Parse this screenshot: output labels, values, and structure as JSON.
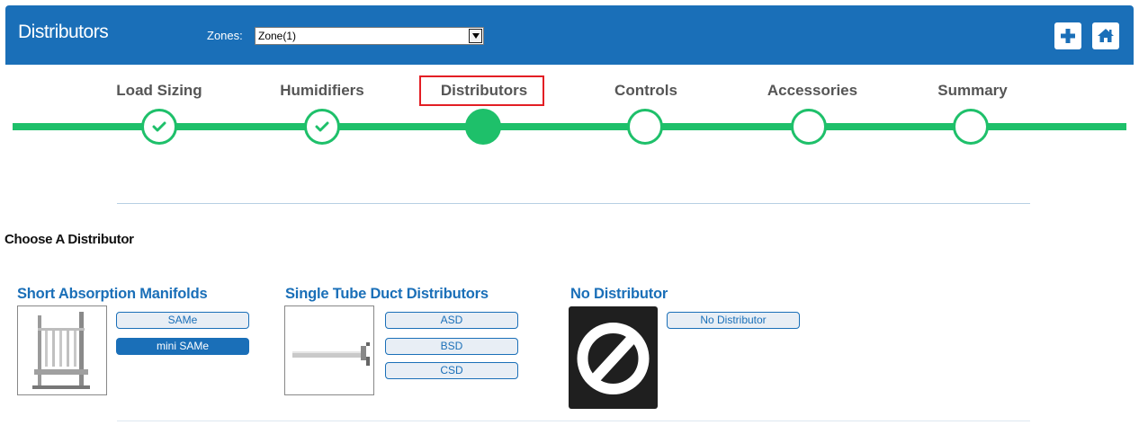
{
  "header": {
    "title": "Distributors",
    "zones_label": "Zones:",
    "zones_value": "Zone(1)"
  },
  "steps": [
    {
      "label": "Load Sizing",
      "state": "complete"
    },
    {
      "label": "Humidifiers",
      "state": "complete"
    },
    {
      "label": "Distributors",
      "state": "current"
    },
    {
      "label": "Controls",
      "state": "pending"
    },
    {
      "label": "Accessories",
      "state": "pending"
    },
    {
      "label": "Summary",
      "state": "pending"
    }
  ],
  "section_title": "Choose A Distributor",
  "groups": [
    {
      "title": "Short Absorption Manifolds",
      "options": [
        {
          "label": "SAMe",
          "selected": false
        },
        {
          "label": "mini SAMe",
          "selected": true
        }
      ]
    },
    {
      "title": "Single Tube Duct Distributors",
      "options": [
        {
          "label": "ASD",
          "selected": false
        },
        {
          "label": "BSD",
          "selected": false
        },
        {
          "label": "CSD",
          "selected": false
        }
      ]
    },
    {
      "title": "No Distributor",
      "options": [
        {
          "label": "No Distributor",
          "selected": false
        }
      ]
    }
  ],
  "colors": {
    "primary": "#1a6fb8",
    "progress": "#1ec06a",
    "highlight": "#e31e24"
  },
  "icons": {
    "add": "plus-icon",
    "home": "home-icon"
  }
}
